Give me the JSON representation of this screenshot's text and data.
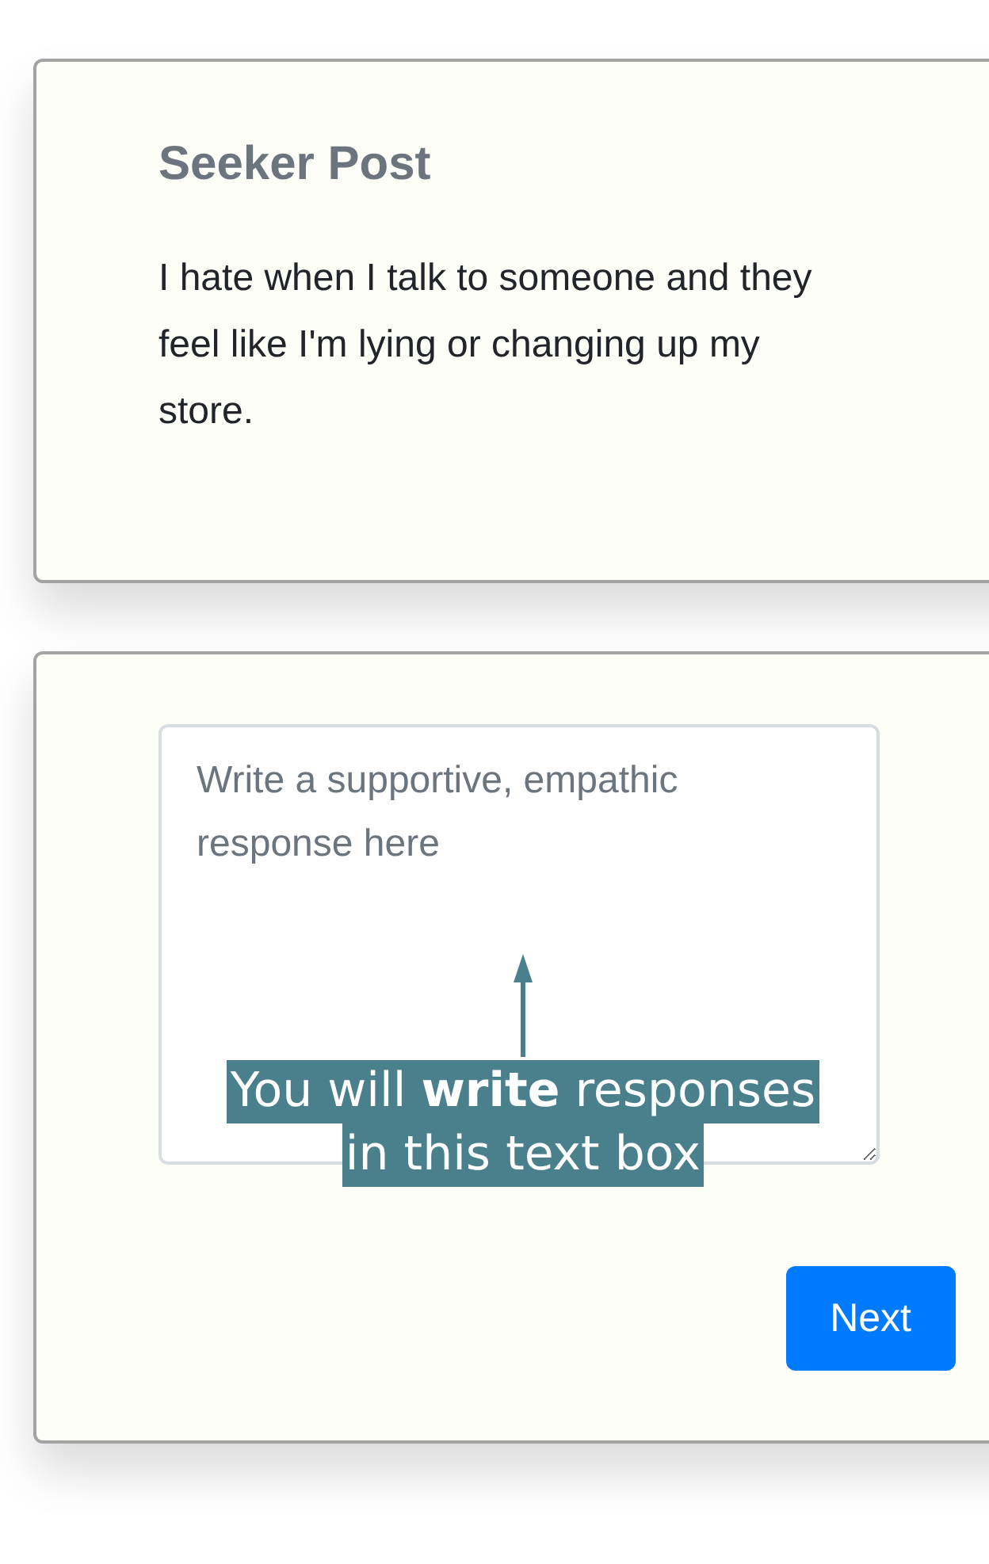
{
  "seeker_post": {
    "title": "Seeker Post",
    "text": "I hate when I talk to someone and they feel like I'm lying or changing up my store."
  },
  "response": {
    "placeholder": "Write a supportive, empathic response here"
  },
  "annotation": {
    "lines": [
      "You will **write** responses",
      "in this text box"
    ]
  },
  "buttons": [
    {
      "label": "Next"
    }
  ]
}
